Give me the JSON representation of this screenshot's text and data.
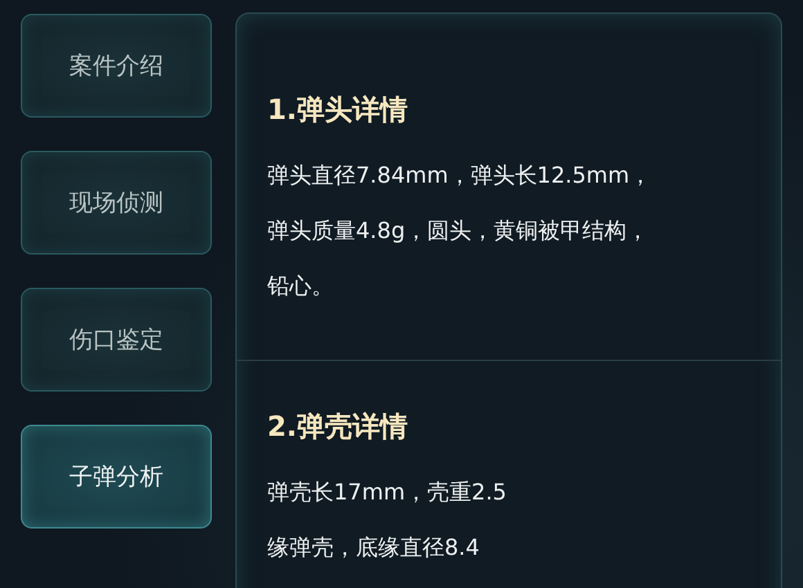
{
  "tabs": [
    {
      "label": "案件介绍",
      "selected": false
    },
    {
      "label": "现场侦测",
      "selected": false
    },
    {
      "label": "伤口鉴定",
      "selected": false
    },
    {
      "label": "子弹分析",
      "selected": true
    }
  ],
  "sections": [
    {
      "title": "1.弹头详情",
      "lines": [
        "弹头直径7.84mm，弹头长12.5mm，",
        "弹头质量4.8g，圆头，黄铜被甲结构，",
        "铅心。"
      ]
    },
    {
      "title": "2.弹壳详情",
      "lines": [
        "弹壳长17mm，壳重2.5",
        "缘弹壳，底缘直径8.4"
      ]
    }
  ]
}
